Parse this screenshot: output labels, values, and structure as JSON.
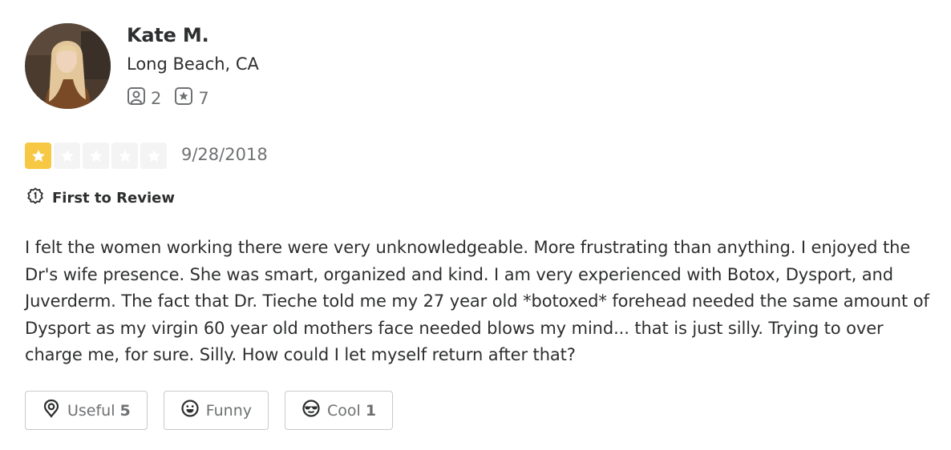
{
  "user": {
    "name": "Kate M.",
    "location": "Long Beach, CA",
    "friends_count": "2",
    "reviews_count": "7"
  },
  "rating": {
    "stars": 1,
    "max": 5,
    "date": "9/28/2018",
    "filled_color": "#f7c844"
  },
  "badge": {
    "label": "First to Review",
    "icon": "first-to-review-badge-icon"
  },
  "review": {
    "text": "I felt the women working there were very unknowledgeable. More frustrating than anything. I enjoyed the Dr's wife presence. She was smart, organized and kind. I am very experienced with Botox, Dysport, and Juverderm. The fact that Dr. Tieche told me my 27 year old *botoxed* forehead needed the same amount of Dysport as my virgin 60 year old mothers face needed blows my mind... that is just silly. Trying to over charge me, for sure. Silly. How could I let myself return after that?"
  },
  "reactions": {
    "useful": {
      "label": "Useful",
      "count": "5",
      "icon": "lightbulb-icon"
    },
    "funny": {
      "label": "Funny",
      "count": "",
      "icon": "smiley-icon"
    },
    "cool": {
      "label": "Cool",
      "count": "1",
      "icon": "sunglasses-smiley-icon"
    }
  }
}
